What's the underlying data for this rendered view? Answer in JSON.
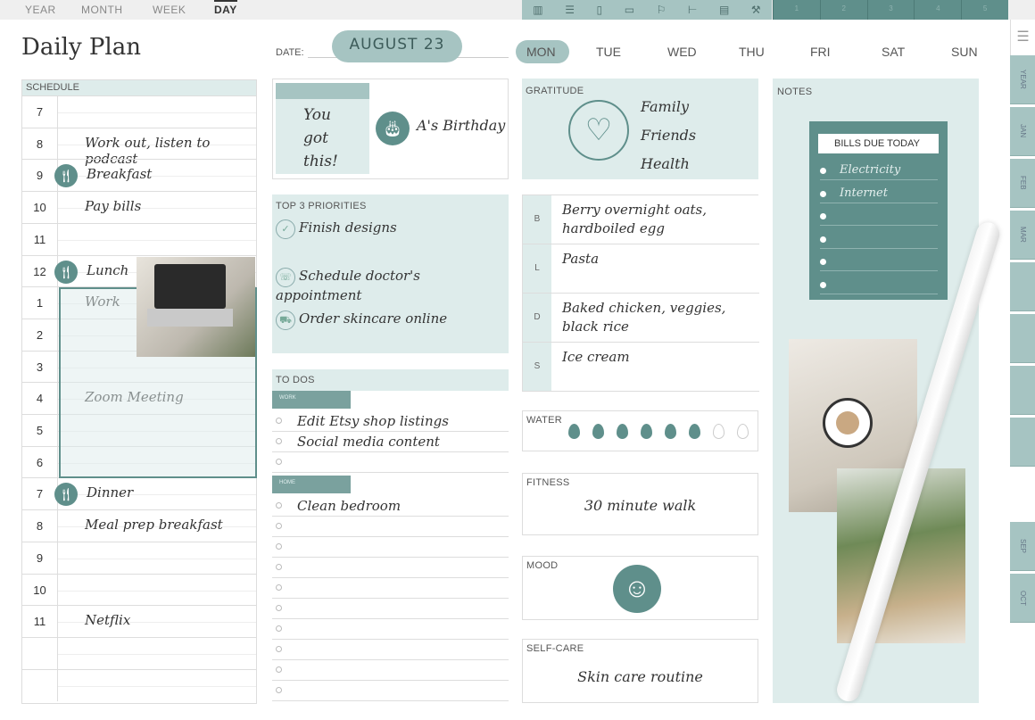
{
  "nav": {
    "tabs": [
      "YEAR",
      "MONTH",
      "WEEK",
      "DAY"
    ],
    "active": "DAY",
    "tool_icons": [
      "layout-icon",
      "list-icon",
      "note-icon",
      "page-icon",
      "flag-icon",
      "tree-icon",
      "stack-icon",
      "tools-icon"
    ],
    "pages": [
      "1",
      "2",
      "3",
      "4",
      "5"
    ]
  },
  "header": {
    "title": "Daily Plan",
    "date_label": "DATE:",
    "date_value": "AUGUST 23",
    "days": [
      "MON",
      "TUE",
      "WED",
      "THU",
      "FRI",
      "SAT",
      "SUN"
    ],
    "selected_day": "MON"
  },
  "schedule": {
    "label": "SCHEDULE",
    "hours": [
      {
        "h": "7",
        "text": ""
      },
      {
        "h": "8",
        "text": "Work out, listen to podcast"
      },
      {
        "h": "9",
        "text": "Breakfast",
        "meal": true
      },
      {
        "h": "10",
        "text": "Pay bills"
      },
      {
        "h": "11",
        "text": ""
      },
      {
        "h": "12",
        "text": "Lunch",
        "meal": true
      },
      {
        "h": "1",
        "text": "Work"
      },
      {
        "h": "2",
        "text": ""
      },
      {
        "h": "3",
        "text": ""
      },
      {
        "h": "4",
        "text": "Zoom Meeting"
      },
      {
        "h": "5",
        "text": ""
      },
      {
        "h": "6",
        "text": ""
      },
      {
        "h": "7",
        "text": "Dinner",
        "meal": true
      },
      {
        "h": "8",
        "text": "Meal prep breakfast"
      },
      {
        "h": "9",
        "text": ""
      },
      {
        "h": "10",
        "text": ""
      },
      {
        "h": "11",
        "text": "Netflix"
      },
      {
        "h": "",
        "text": ""
      },
      {
        "h": "",
        "text": ""
      }
    ]
  },
  "sticky": {
    "note": "You got this!",
    "event": "A's Birthday"
  },
  "priorities": {
    "label": "TOP 3 PRIORITIES",
    "items": [
      {
        "icon": "check-icon",
        "text": "Finish designs"
      },
      {
        "icon": "phone-icon",
        "text": "Schedule doctor's appointment"
      },
      {
        "icon": "cart-icon",
        "text": "Order skincare online"
      }
    ]
  },
  "todos": {
    "label": "TO DOS",
    "groups": [
      {
        "name": "WORK",
        "items": [
          "Edit Etsy shop listings",
          "Social media content",
          ""
        ]
      },
      {
        "name": "HOME",
        "items": [
          "Clean bedroom",
          "",
          "",
          "",
          "",
          "",
          "",
          "",
          "",
          ""
        ]
      }
    ]
  },
  "gratitude": {
    "label": "GRATITUDE",
    "items": [
      "Family",
      "Friends",
      "Health"
    ]
  },
  "meals": [
    {
      "key": "B",
      "text": "Berry overnight oats, hardboiled egg"
    },
    {
      "key": "L",
      "text": "Pasta"
    },
    {
      "key": "D",
      "text": "Baked chicken, veggies, black rice"
    },
    {
      "key": "S",
      "text": "Ice cream"
    }
  ],
  "water": {
    "label": "WATER",
    "filled": 6,
    "total": 8
  },
  "fitness": {
    "label": "FITNESS",
    "text": "30 minute walk"
  },
  "mood": {
    "label": "MOOD",
    "icon": "smiley-icon"
  },
  "selfcare": {
    "label": "SELF-CARE",
    "text": "Skin care routine"
  },
  "notes": {
    "label": "NOTES",
    "bills_title": "BILLS DUE TODAY",
    "bills": [
      "Electricity",
      "Internet",
      "",
      "",
      "",
      ""
    ]
  },
  "side_tabs": [
    "YEAR",
    "JAN",
    "FEB",
    "MAR",
    "",
    "",
    "",
    "",
    "SEP",
    "OCT"
  ],
  "colors": {
    "accent": "#5f8f8b",
    "light": "#deeceb",
    "mid": "#a6c4c2"
  }
}
